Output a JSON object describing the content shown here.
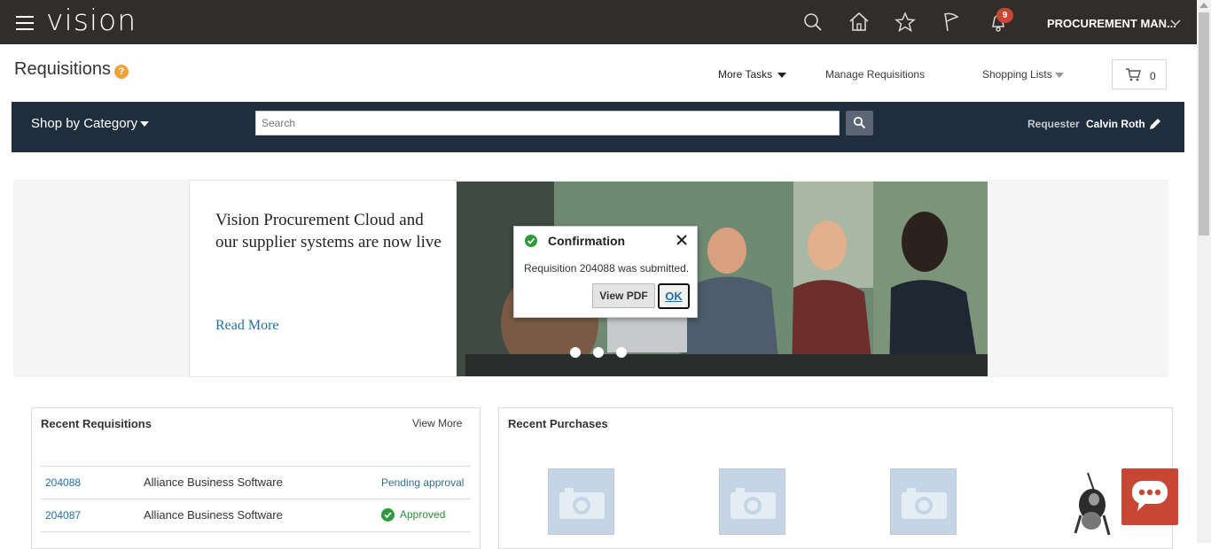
{
  "app": {
    "logo": "vision",
    "notification_count": "9",
    "user_menu_label": "PROCUREMENT MAN..."
  },
  "icons": {
    "menu": "hamburger-menu-icon",
    "search": "search-icon",
    "home": "home-icon",
    "favorites": "star-icon",
    "watchlist": "flag-icon",
    "notifications": "bell-icon",
    "cart": "cart-icon",
    "edit": "pencil-icon",
    "chat": "chat-icon"
  },
  "page": {
    "title": "Requisitions",
    "help": "?",
    "more_tasks": "More Tasks",
    "manage_requisitions": "Manage Requisitions",
    "shopping_lists": "Shopping Lists",
    "cart_count": "0"
  },
  "shopbar": {
    "shop_by_category": "Shop by Category",
    "search_placeholder": "Search",
    "requester_label": "Requester",
    "requester_name": "Calvin Roth"
  },
  "banner": {
    "headline": "Vision Procurement Cloud and our supplier systems are now live",
    "read_more": "Read More",
    "slide_count": 3
  },
  "confirmation": {
    "title": "Confirmation",
    "message": "Requisition 204088 was submitted.",
    "view_pdf": "View PDF",
    "ok": "OK"
  },
  "recent_requisitions": {
    "title": "Recent Requisitions",
    "view_more": "View More",
    "rows": [
      {
        "number": "204088",
        "supplier": "Alliance Business Software",
        "status": "Pending approval"
      },
      {
        "number": "204087",
        "supplier": "Alliance Business Software",
        "status": "Approved"
      }
    ]
  },
  "recent_purchases": {
    "title": "Recent Purchases",
    "item_count_visible": 3
  },
  "colors": {
    "topbar": "#312d2a",
    "shopbar": "#1f2d3d",
    "accent_red": "#c74634",
    "link_blue": "#1f6fae",
    "approved_green": "#2d8a3a"
  }
}
